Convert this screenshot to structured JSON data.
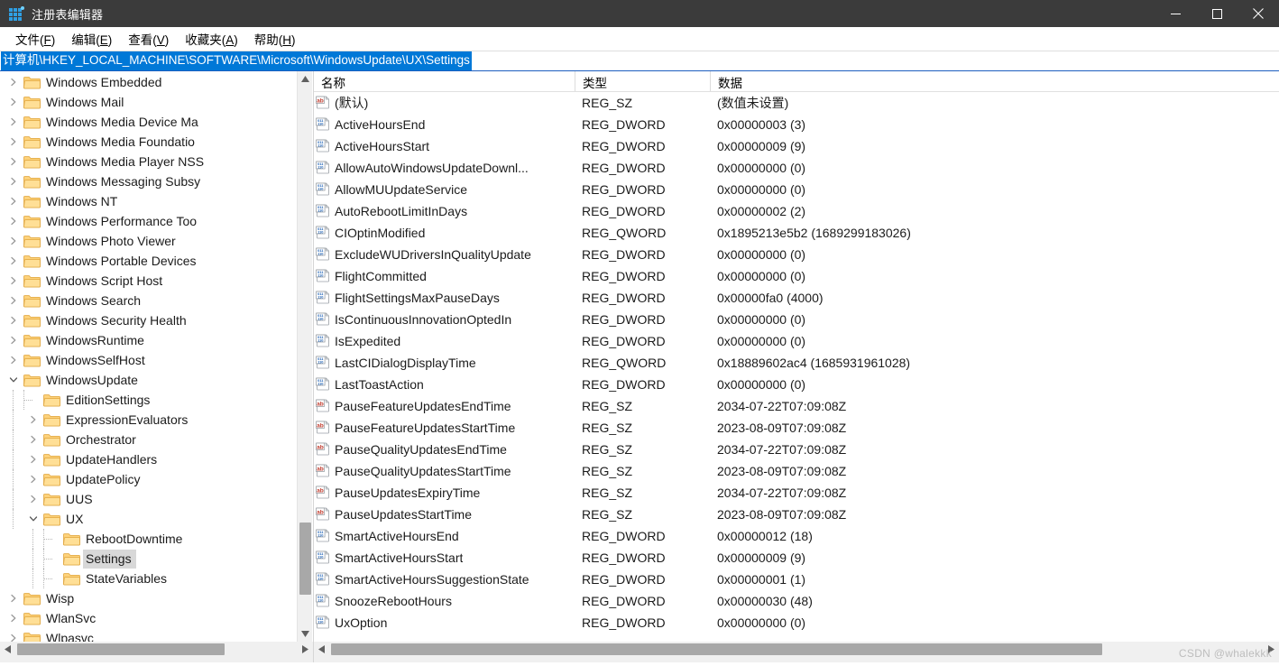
{
  "window": {
    "title": "注册表编辑器",
    "icon": "registry-editor-icon",
    "minimize_label": "最小化",
    "maximize_label": "最大化",
    "close_label": "关闭"
  },
  "menubar": {
    "items": [
      {
        "label": "文件(F)",
        "text": "文件(",
        "accel": "F",
        "tail": ")"
      },
      {
        "label": "编辑(E)",
        "text": "编辑(",
        "accel": "E",
        "tail": ")"
      },
      {
        "label": "查看(V)",
        "text": "查看(",
        "accel": "V",
        "tail": ")"
      },
      {
        "label": "收藏夹(A)",
        "text": "收藏夹(",
        "accel": "A",
        "tail": ")"
      },
      {
        "label": "帮助(H)",
        "text": "帮助(",
        "accel": "H",
        "tail": ")"
      }
    ]
  },
  "address": {
    "path": "计算机\\HKEY_LOCAL_MACHINE\\SOFTWARE\\Microsoft\\WindowsUpdate\\UX\\Settings",
    "selected": true,
    "selection_color": "#0078d7"
  },
  "tree": {
    "items": [
      {
        "label": "Windows Embedded",
        "depth": 1,
        "state": "collapsed"
      },
      {
        "label": "Windows Mail",
        "depth": 1,
        "state": "collapsed"
      },
      {
        "label": "Windows Media Device Ma",
        "depth": 1,
        "state": "collapsed"
      },
      {
        "label": "Windows Media Foundatio",
        "depth": 1,
        "state": "collapsed"
      },
      {
        "label": "Windows Media Player NSS",
        "depth": 1,
        "state": "collapsed"
      },
      {
        "label": "Windows Messaging Subsy",
        "depth": 1,
        "state": "collapsed"
      },
      {
        "label": "Windows NT",
        "depth": 1,
        "state": "collapsed"
      },
      {
        "label": "Windows Performance Too",
        "depth": 1,
        "state": "collapsed"
      },
      {
        "label": "Windows Photo Viewer",
        "depth": 1,
        "state": "collapsed"
      },
      {
        "label": "Windows Portable Devices",
        "depth": 1,
        "state": "collapsed"
      },
      {
        "label": "Windows Script Host",
        "depth": 1,
        "state": "collapsed"
      },
      {
        "label": "Windows Search",
        "depth": 1,
        "state": "collapsed"
      },
      {
        "label": "Windows Security Health",
        "depth": 1,
        "state": "collapsed"
      },
      {
        "label": "WindowsRuntime",
        "depth": 1,
        "state": "collapsed"
      },
      {
        "label": "WindowsSelfHost",
        "depth": 1,
        "state": "collapsed"
      },
      {
        "label": "WindowsUpdate",
        "depth": 1,
        "state": "expanded"
      },
      {
        "label": "EditionSettings",
        "depth": 2,
        "state": "leaf"
      },
      {
        "label": "ExpressionEvaluators",
        "depth": 2,
        "state": "collapsed"
      },
      {
        "label": "Orchestrator",
        "depth": 2,
        "state": "collapsed"
      },
      {
        "label": "UpdateHandlers",
        "depth": 2,
        "state": "collapsed"
      },
      {
        "label": "UpdatePolicy",
        "depth": 2,
        "state": "collapsed"
      },
      {
        "label": "UUS",
        "depth": 2,
        "state": "collapsed"
      },
      {
        "label": "UX",
        "depth": 2,
        "state": "expanded"
      },
      {
        "label": "RebootDowntime",
        "depth": 3,
        "state": "leaf"
      },
      {
        "label": "Settings",
        "depth": 3,
        "state": "leaf",
        "selected": true
      },
      {
        "label": "StateVariables",
        "depth": 3,
        "state": "leaf"
      },
      {
        "label": "Wisp",
        "depth": 1,
        "state": "collapsed"
      },
      {
        "label": "WlanSvc",
        "depth": 1,
        "state": "collapsed"
      },
      {
        "label": "Wlpasvc",
        "depth": 1,
        "state": "collapsed"
      }
    ]
  },
  "list": {
    "columns": [
      "名称",
      "类型",
      "数据"
    ],
    "rows": [
      {
        "name": "(默认)",
        "type": "REG_SZ",
        "data": "(数值未设置)",
        "icon": "string-value-icon"
      },
      {
        "name": "ActiveHoursEnd",
        "type": "REG_DWORD",
        "data": "0x00000003 (3)",
        "icon": "dword-value-icon"
      },
      {
        "name": "ActiveHoursStart",
        "type": "REG_DWORD",
        "data": "0x00000009 (9)",
        "icon": "dword-value-icon"
      },
      {
        "name": "AllowAutoWindowsUpdateDownl...",
        "type": "REG_DWORD",
        "data": "0x00000000 (0)",
        "icon": "dword-value-icon"
      },
      {
        "name": "AllowMUUpdateService",
        "type": "REG_DWORD",
        "data": "0x00000000 (0)",
        "icon": "dword-value-icon"
      },
      {
        "name": "AutoRebootLimitInDays",
        "type": "REG_DWORD",
        "data": "0x00000002 (2)",
        "icon": "dword-value-icon"
      },
      {
        "name": "CIOptinModified",
        "type": "REG_QWORD",
        "data": "0x1895213e5b2 (1689299183026)",
        "icon": "dword-value-icon"
      },
      {
        "name": "ExcludeWUDriversInQualityUpdate",
        "type": "REG_DWORD",
        "data": "0x00000000 (0)",
        "icon": "dword-value-icon"
      },
      {
        "name": "FlightCommitted",
        "type": "REG_DWORD",
        "data": "0x00000000 (0)",
        "icon": "dword-value-icon"
      },
      {
        "name": "FlightSettingsMaxPauseDays",
        "type": "REG_DWORD",
        "data": "0x00000fa0 (4000)",
        "icon": "dword-value-icon"
      },
      {
        "name": "IsContinuousInnovationOptedIn",
        "type": "REG_DWORD",
        "data": "0x00000000 (0)",
        "icon": "dword-value-icon"
      },
      {
        "name": "IsExpedited",
        "type": "REG_DWORD",
        "data": "0x00000000 (0)",
        "icon": "dword-value-icon"
      },
      {
        "name": "LastCIDialogDisplayTime",
        "type": "REG_QWORD",
        "data": "0x18889602ac4 (1685931961028)",
        "icon": "dword-value-icon"
      },
      {
        "name": "LastToastAction",
        "type": "REG_DWORD",
        "data": "0x00000000 (0)",
        "icon": "dword-value-icon"
      },
      {
        "name": "PauseFeatureUpdatesEndTime",
        "type": "REG_SZ",
        "data": "2034-07-22T07:09:08Z",
        "icon": "string-value-icon"
      },
      {
        "name": "PauseFeatureUpdatesStartTime",
        "type": "REG_SZ",
        "data": "2023-08-09T07:09:08Z",
        "icon": "string-value-icon"
      },
      {
        "name": "PauseQualityUpdatesEndTime",
        "type": "REG_SZ",
        "data": "2034-07-22T07:09:08Z",
        "icon": "string-value-icon"
      },
      {
        "name": "PauseQualityUpdatesStartTime",
        "type": "REG_SZ",
        "data": "2023-08-09T07:09:08Z",
        "icon": "string-value-icon"
      },
      {
        "name": "PauseUpdatesExpiryTime",
        "type": "REG_SZ",
        "data": "2034-07-22T07:09:08Z",
        "icon": "string-value-icon"
      },
      {
        "name": "PauseUpdatesStartTime",
        "type": "REG_SZ",
        "data": "2023-08-09T07:09:08Z",
        "icon": "string-value-icon"
      },
      {
        "name": "SmartActiveHoursEnd",
        "type": "REG_DWORD",
        "data": "0x00000012 (18)",
        "icon": "dword-value-icon"
      },
      {
        "name": "SmartActiveHoursStart",
        "type": "REG_DWORD",
        "data": "0x00000009 (9)",
        "icon": "dword-value-icon"
      },
      {
        "name": "SmartActiveHoursSuggestionState",
        "type": "REG_DWORD",
        "data": "0x00000001 (1)",
        "icon": "dword-value-icon"
      },
      {
        "name": "SnoozeRebootHours",
        "type": "REG_DWORD",
        "data": "0x00000030 (48)",
        "icon": "dword-value-icon"
      },
      {
        "name": "UxOption",
        "type": "REG_DWORD",
        "data": "0x00000000 (0)",
        "icon": "dword-value-icon"
      }
    ]
  },
  "watermark": "CSDN @whalekkk",
  "colors": {
    "titlebar": "#3b3b3b",
    "accent": "#0078d7",
    "folder": "#ffd272",
    "selection_gray": "#d8d8d8",
    "string_icon": "#c0392b",
    "dword_icon": "#1a5fb4"
  }
}
